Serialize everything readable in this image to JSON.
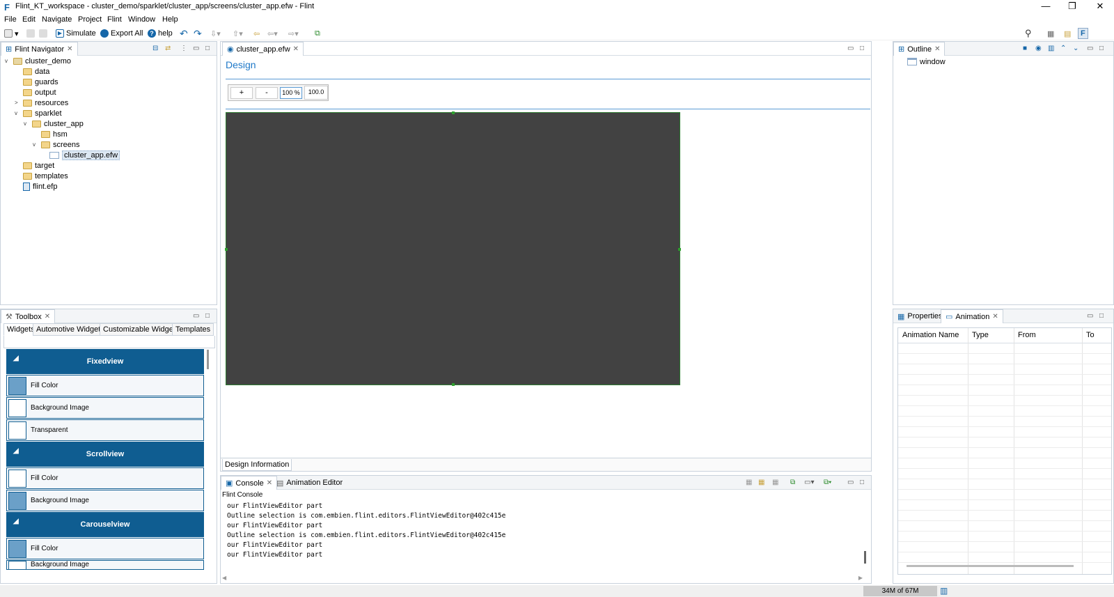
{
  "window": {
    "title": "Flint_KT_workspace - cluster_demo/sparklet/cluster_app/screens/cluster_app.efw - Flint",
    "app_icon": "F",
    "minimize": "—",
    "restore": "❐",
    "close": "✕"
  },
  "menu": [
    "File",
    "Edit",
    "Navigate",
    "Project",
    "Flint",
    "Window",
    "Help"
  ],
  "toolbar": {
    "simulate": "Simulate",
    "export_all": "Export All",
    "help": "help"
  },
  "navigator": {
    "tab_label": "Flint Navigator",
    "tree": [
      {
        "label": "cluster_demo",
        "depth": 0,
        "expanded": true,
        "type": "project"
      },
      {
        "label": "data",
        "depth": 1,
        "type": "folder"
      },
      {
        "label": "guards",
        "depth": 1,
        "type": "folder"
      },
      {
        "label": "output",
        "depth": 1,
        "type": "folder"
      },
      {
        "label": "resources",
        "depth": 1,
        "type": "folder",
        "collapsed": true
      },
      {
        "label": "sparklet",
        "depth": 1,
        "type": "folder",
        "expanded": true
      },
      {
        "label": "cluster_app",
        "depth": 2,
        "type": "folder",
        "expanded": true
      },
      {
        "label": "hsm",
        "depth": 3,
        "type": "folder"
      },
      {
        "label": "screens",
        "depth": 3,
        "type": "folder",
        "expanded": true
      },
      {
        "label": "cluster_app.efw",
        "depth": 4,
        "type": "file",
        "selected": true
      },
      {
        "label": "target",
        "depth": 1,
        "type": "folder"
      },
      {
        "label": "templates",
        "depth": 1,
        "type": "folder"
      },
      {
        "label": "flint.efp",
        "depth": 1,
        "type": "file"
      }
    ]
  },
  "editor": {
    "tab_label": "cluster_app.efw",
    "heading": "Design",
    "zoom_in": "+",
    "zoom_out": "-",
    "zoom_percent": "100 %",
    "zoom_value": "100.0",
    "bottom_tab": "Design Information"
  },
  "outline": {
    "tab_label": "Outline",
    "items": [
      "window"
    ]
  },
  "toolbox": {
    "tab_label": "Toolbox",
    "tabs": [
      "Widgets",
      "Automotive Widgets",
      "Customizable Widgets",
      "Templates"
    ],
    "categories": [
      {
        "name": "Fixedview",
        "widgets": [
          "Fill Color",
          "Background Image",
          "Transparent"
        ]
      },
      {
        "name": "Scrollview",
        "widgets": [
          "Fill Color",
          "Background Image"
        ]
      },
      {
        "name": "Carouselview",
        "widgets": [
          "Fill Color",
          "Background Image"
        ]
      }
    ]
  },
  "properties": {
    "tab_properties": "Properties",
    "tab_animation": "Animation",
    "columns": [
      "Animation Name",
      "Type",
      "From",
      "To"
    ]
  },
  "console": {
    "tab_console": "Console",
    "tab_animation_editor": "Animation Editor",
    "title": "Flint Console",
    "lines": [
      "our FlintViewEditor part",
      "Outline selection is com.embien.flint.editors.FlintViewEditor@402c415e",
      "our FlintViewEditor part",
      "Outline selection is com.embien.flint.editors.FlintViewEditor@402c415e",
      "our FlintViewEditor part",
      "our FlintViewEditor part"
    ]
  },
  "status": {
    "heap": "34M of 67M"
  },
  "colors": {
    "accent": "#0f5d91",
    "canvas": "#424242",
    "heading": "#1e78c8"
  }
}
